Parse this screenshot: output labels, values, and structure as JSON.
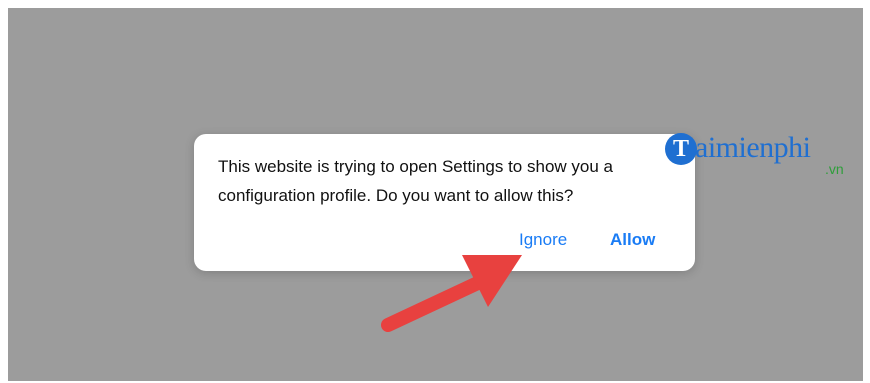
{
  "dialog": {
    "message": "This website is trying to open Settings to show you a configuration profile. Do you want to allow this?",
    "ignore_label": "Ignore",
    "allow_label": "Allow"
  },
  "watermark": {
    "badge": "T",
    "name": "aimienphi",
    "suffix": ".vn"
  },
  "colors": {
    "backdrop": "#9c9c9c",
    "dialog_bg": "#ffffff",
    "button_text": "#1a7cf5",
    "arrow": "#e8413f",
    "watermark_blue": "#1f6fd1",
    "watermark_green": "#2e9e3a"
  }
}
